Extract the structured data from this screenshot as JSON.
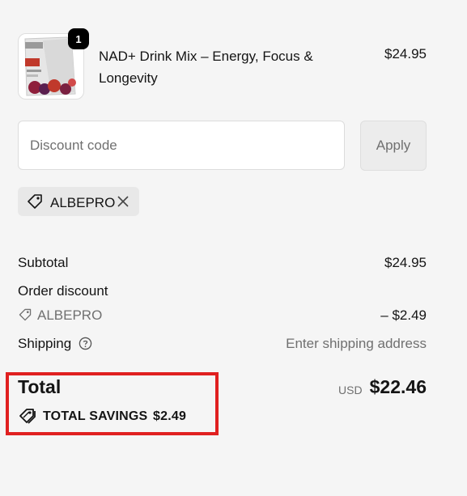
{
  "cart": {
    "item": {
      "name": "NAD+ Drink Mix – Energy, Focus & Longevity",
      "price": "$24.95",
      "quantity": "1",
      "image": "nad-drink-mix-pouch"
    }
  },
  "discount": {
    "placeholder": "Discount code",
    "apply_label": "Apply",
    "applied_code": "ALBEPRO"
  },
  "summary": {
    "subtotal_label": "Subtotal",
    "subtotal_value": "$24.95",
    "order_discount_label": "Order discount",
    "discount_code": "ALBEPRO",
    "discount_value": "– $2.49",
    "shipping_label": "Shipping",
    "shipping_value": "Enter shipping address",
    "total_label": "Total",
    "currency": "USD",
    "total_value": "$22.46",
    "savings_label": "TOTAL SAVINGS",
    "savings_value": "$2.49"
  },
  "colors": {
    "background": "#f5f5f5",
    "highlight_border": "#e02020",
    "muted_text": "#707070"
  }
}
